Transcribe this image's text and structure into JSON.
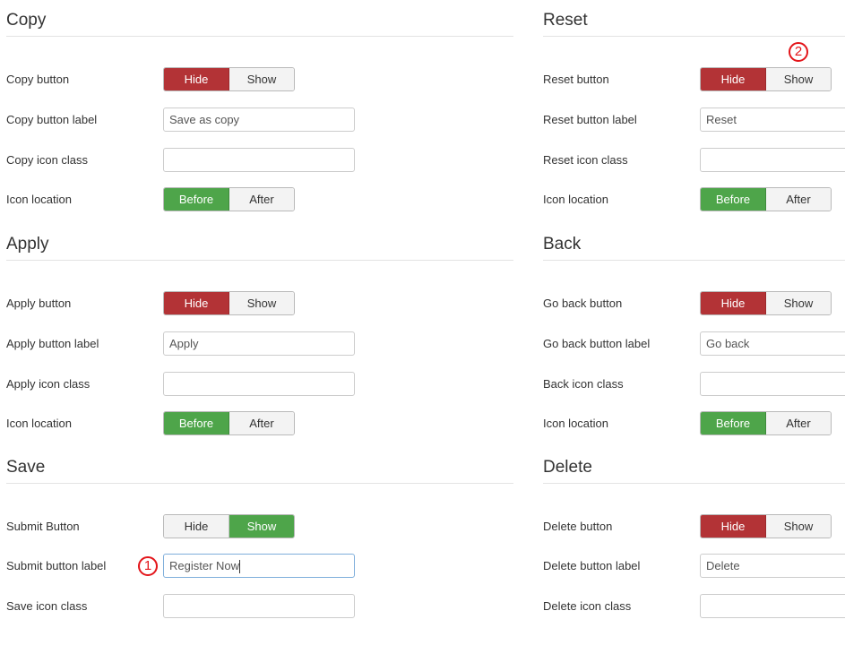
{
  "colors": {
    "hide_active": "#b33336",
    "show_before_active": "#4ea54a",
    "inactive_option": "#f3f3f3",
    "callout": "#e3151a"
  },
  "left_column": [
    {
      "title": "Copy",
      "rows": [
        {
          "type": "toggle",
          "label": "Copy button",
          "options": [
            "Hide",
            "Show"
          ],
          "selected": "Hide"
        },
        {
          "type": "text",
          "label": "Copy button label",
          "value": "Save as copy"
        },
        {
          "type": "text",
          "label": "Copy icon class",
          "value": ""
        },
        {
          "type": "toggle",
          "label": "Icon location",
          "options": [
            "Before",
            "After"
          ],
          "selected": "Before"
        }
      ]
    },
    {
      "title": "Apply",
      "rows": [
        {
          "type": "toggle",
          "label": "Apply button",
          "options": [
            "Hide",
            "Show"
          ],
          "selected": "Hide"
        },
        {
          "type": "text",
          "label": "Apply button label",
          "value": "Apply"
        },
        {
          "type": "text",
          "label": "Apply icon class",
          "value": ""
        },
        {
          "type": "toggle",
          "label": "Icon location",
          "options": [
            "Before",
            "After"
          ],
          "selected": "Before"
        }
      ]
    },
    {
      "title": "Save",
      "rows": [
        {
          "type": "toggle",
          "label": "Submit Button",
          "options": [
            "Hide",
            "Show"
          ],
          "selected": "Show"
        },
        {
          "type": "text",
          "label": "Submit button label",
          "value": "Register Now",
          "focused": true
        },
        {
          "type": "text",
          "label": "Save icon class",
          "value": ""
        }
      ]
    }
  ],
  "right_column": [
    {
      "title": "Reset",
      "rows": [
        {
          "type": "toggle",
          "label": "Reset button",
          "options": [
            "Hide",
            "Show"
          ],
          "selected": "Hide"
        },
        {
          "type": "text",
          "label": "Reset button label",
          "value": "Reset"
        },
        {
          "type": "text",
          "label": "Reset icon class",
          "value": ""
        },
        {
          "type": "toggle",
          "label": "Icon location",
          "options": [
            "Before",
            "After"
          ],
          "selected": "Before"
        }
      ]
    },
    {
      "title": "Back",
      "rows": [
        {
          "type": "toggle",
          "label": "Go back button",
          "options": [
            "Hide",
            "Show"
          ],
          "selected": "Hide"
        },
        {
          "type": "text",
          "label": "Go back button label",
          "value": "Go back"
        },
        {
          "type": "text",
          "label": "Back icon class",
          "value": ""
        },
        {
          "type": "toggle",
          "label": "Icon location",
          "options": [
            "Before",
            "After"
          ],
          "selected": "Before"
        }
      ]
    },
    {
      "title": "Delete",
      "rows": [
        {
          "type": "toggle",
          "label": "Delete button",
          "options": [
            "Hide",
            "Show"
          ],
          "selected": "Hide"
        },
        {
          "type": "text",
          "label": "Delete button label",
          "value": "Delete"
        },
        {
          "type": "text",
          "label": "Delete icon class",
          "value": ""
        }
      ]
    }
  ],
  "callouts": [
    {
      "number": "1",
      "target": "Submit button label"
    },
    {
      "number": "2",
      "target": "Reset button Show option"
    }
  ]
}
